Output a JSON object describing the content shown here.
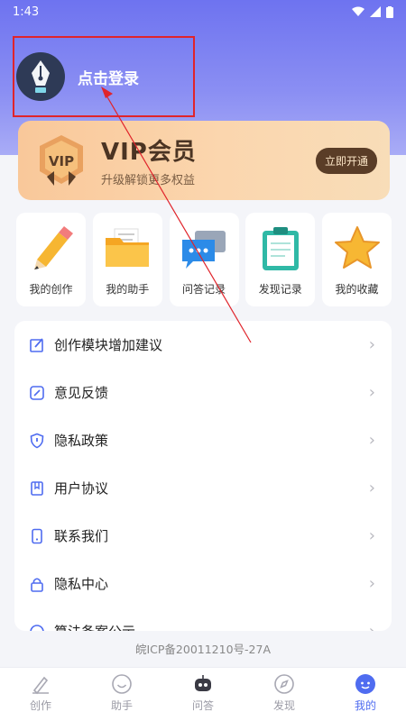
{
  "status_bar": {
    "time": "1:43"
  },
  "profile": {
    "login_text": "点击登录"
  },
  "vip": {
    "badge_text": "VIP",
    "title": "VIP会员",
    "subtitle": "升级解锁更多权益",
    "button": "立即开通"
  },
  "quick_actions": [
    {
      "label": "我的创作",
      "icon": "pencil-icon"
    },
    {
      "label": "我的助手",
      "icon": "folder-icon"
    },
    {
      "label": "问答记录",
      "icon": "chat-icon"
    },
    {
      "label": "发现记录",
      "icon": "clipboard-icon"
    },
    {
      "label": "我的收藏",
      "icon": "star-icon"
    }
  ],
  "menu": [
    {
      "label": "创作模块增加建议",
      "icon": "edit-icon"
    },
    {
      "label": "意见反馈",
      "icon": "feedback-icon"
    },
    {
      "label": "隐私政策",
      "icon": "shield-icon"
    },
    {
      "label": "用户协议",
      "icon": "bookmark-icon"
    },
    {
      "label": "联系我们",
      "icon": "phone-icon"
    },
    {
      "label": "隐私中心",
      "icon": "lock-icon"
    },
    {
      "label": "算法备案公示",
      "icon": "algorithm-icon"
    }
  ],
  "icp": "皖ICP备20011210号-27A",
  "tabs": [
    {
      "label": "创作",
      "icon": "pen-icon",
      "active": false
    },
    {
      "label": "助手",
      "icon": "smile-icon",
      "active": false
    },
    {
      "label": "问答",
      "icon": "robot-icon",
      "active": false
    },
    {
      "label": "发现",
      "icon": "compass-icon",
      "active": false
    },
    {
      "label": "我的",
      "icon": "profile-face-icon",
      "active": true
    }
  ],
  "colors": {
    "accent": "#4f6cf0",
    "header": "#6e73f0",
    "highlight": "#e0242b"
  }
}
